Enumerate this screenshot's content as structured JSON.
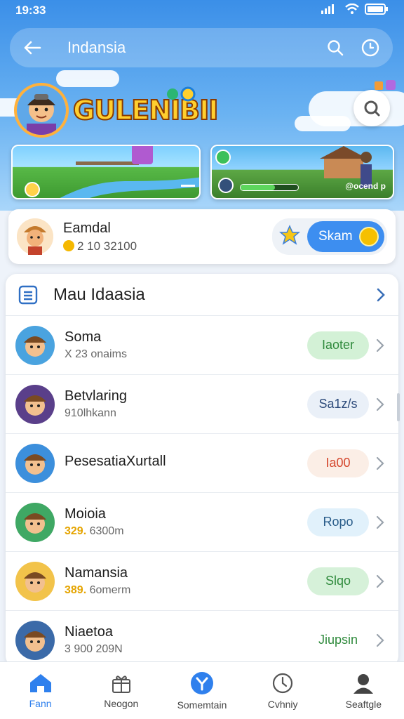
{
  "status_bar": {
    "time": "19:33"
  },
  "app_bar": {
    "title": "Indansia"
  },
  "hero": {
    "logo_text": "GULENIBII"
  },
  "banners": [
    {
      "text": ""
    },
    {
      "text": "@ocend p",
      "progress": 0.6
    }
  ],
  "profile": {
    "name": "Eamdal",
    "stats": "2 10  32100",
    "scan_label": "Skam"
  },
  "list": {
    "title": "Mau Idaasia",
    "rows": [
      {
        "name": "Soma",
        "sub": "X 23 onaims",
        "button": "Iaoter",
        "btn_bg": "#d3f1d6",
        "btn_color": "#2f8a3c"
      },
      {
        "name": "Betvlaring",
        "sub": "910lhkann",
        "button": "Sa1z/s",
        "btn_bg": "#eaf0f8",
        "btn_color": "#2c4a7a"
      },
      {
        "name": "PesesatiaXurtall",
        "sub": "",
        "button": "Ia00",
        "btn_bg": "#fbeee6",
        "btn_color": "#d4452b"
      },
      {
        "name": "Moioia",
        "sub_hl": "329.",
        "sub": "6300m",
        "button": "Ropo",
        "btn_bg": "#e1f1fb",
        "btn_color": "#2a5d8a"
      },
      {
        "name": "Namansia",
        "sub_hl": "389.",
        "sub": "6omerm",
        "button": "Slqo",
        "btn_bg": "#d6f1d9",
        "btn_color": "#2f8a3c"
      },
      {
        "name": "Niaetoa",
        "sub": "3 900 209N",
        "button": "Jiupsin",
        "btn_bg": "#ffffff",
        "btn_color": "#2f8a3c"
      }
    ]
  },
  "nav": [
    {
      "label": "Fann",
      "icon": "home-icon",
      "active": true
    },
    {
      "label": "Neogon",
      "icon": "gift-icon",
      "active": false
    },
    {
      "label": "Somemtain",
      "icon": "badge-icon",
      "active": false
    },
    {
      "label": "Cvhniy",
      "icon": "clock-icon",
      "active": false
    },
    {
      "label": "Seaftgle",
      "icon": "profile-icon",
      "active": false
    }
  ]
}
